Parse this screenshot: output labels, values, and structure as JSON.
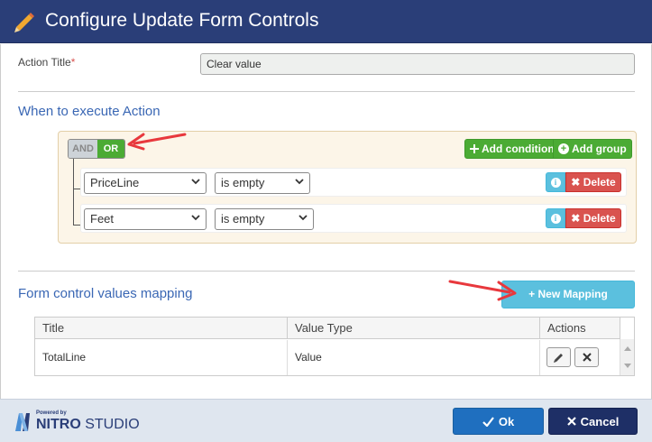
{
  "dialog": {
    "title": "Configure Update Form Controls"
  },
  "action_title": {
    "label": "Action Title",
    "required_mark": "*",
    "value": "Clear value"
  },
  "when_section": {
    "title": "When to execute Action",
    "and_label": "AND",
    "or_label": "OR",
    "selected_operator": "OR",
    "add_condition_label": "Add condition",
    "add_group_label": "Add group",
    "rules": [
      {
        "field": "PriceLine",
        "operator": "is empty",
        "delete_label": "Delete"
      },
      {
        "field": "Feet",
        "operator": "is empty",
        "delete_label": "Delete"
      }
    ]
  },
  "mapping_section": {
    "title": "Form control values mapping",
    "new_mapping_label": "New Mapping",
    "columns": [
      "Title",
      "Value Type",
      "Actions"
    ],
    "rows": [
      {
        "title": "TotalLine",
        "value_type": "Value"
      }
    ]
  },
  "footer": {
    "brand_small": "Powered by",
    "brand_name": "NITRO",
    "brand_product": "STUDIO",
    "ok_label": "Ok",
    "cancel_label": "Cancel"
  },
  "colors": {
    "header_bg": "#2a3e78",
    "section_title": "#3a67b4",
    "green": "#4bab34",
    "info": "#5bc0de",
    "danger": "#d9534f",
    "ok": "#1f6fbf",
    "cancel": "#1e2f66",
    "annotation_arrow": "#e8383d"
  },
  "icons": {
    "title": "pencil-icon",
    "add_condition": "plus-icon",
    "add_group": "plus-circle-icon",
    "info": "info-icon",
    "delete": "close-icon",
    "edit": "pencil-icon",
    "remove": "close-icon",
    "ok": "check-icon",
    "cancel": "close-icon"
  }
}
